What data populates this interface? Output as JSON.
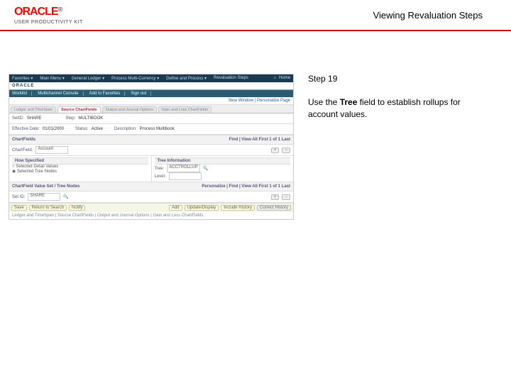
{
  "header": {
    "brand": "ORACLE",
    "tm": "®",
    "product": "USER PRODUCTIVITY KIT",
    "title": "Viewing Revaluation Steps"
  },
  "step": {
    "label": "Step 19",
    "text_before": "Use the ",
    "text_bold": "Tree",
    "text_after": " field to establish rollups for account values."
  },
  "shot": {
    "nav1": [
      "Favorites ▾",
      "Main Menu ▾",
      "General Ledger ▾",
      "Process Multi-Currency ▾",
      "Define and Process ▾",
      "Revaluation Steps"
    ],
    "home": "Home",
    "brand": "ORACLE",
    "nav2": [
      "Worklist",
      "Multichannel Console",
      "Add to Favorites",
      "Sign out"
    ],
    "crumb": "New Window | Personalize Page",
    "tabs": [
      "Ledger and TimeSpan",
      "Source ChartFields",
      "Output and Journal Options",
      "Gain and Loss ChartFields"
    ],
    "tab_active": 1,
    "row1": {
      "setid_lbl": "SetID:",
      "setid": "SHARE",
      "step_lbl": "Step:",
      "step": "MULTIBOOK"
    },
    "row2": {
      "eff_lbl": "Effective Date:",
      "eff": "01/01/2000",
      "stat_lbl": "Status:",
      "stat": "Active",
      "desc_lbl": "Description:",
      "desc": "Process Multibook"
    },
    "cf_head": "ChartFields",
    "cf_pager": "Find | View All    First  1 of 1  Last",
    "cf_row": {
      "lbl": "ChartField:",
      "val": "Account"
    },
    "spec_head": "How Specified",
    "tree_head": "Tree Information",
    "radios": [
      "Selected Detail Values",
      "Selected Tree Nodes"
    ],
    "radio_sel": 1,
    "tree": {
      "lbl": "Tree:",
      "val": "ACCTROLLUP",
      "lvl_lbl": "Level:"
    },
    "cfval": {
      "head": "ChartField Value Set / Tree Nodes",
      "pager": "Personalize | Find | View All    First  1 of 1  Last",
      "lbl": "Set ID:",
      "val": "SHARE"
    },
    "buttons": {
      "save": "Save",
      "ret": "Return to Search",
      "notify": "Notify",
      "add": "Add",
      "upd": "Update/Display",
      "inc": "Include History",
      "corr": "Correct History"
    },
    "foot": "Ledger and TimeSpan | Source ChartFields | Output and Journal Options | Gain and Loss ChartFields"
  }
}
